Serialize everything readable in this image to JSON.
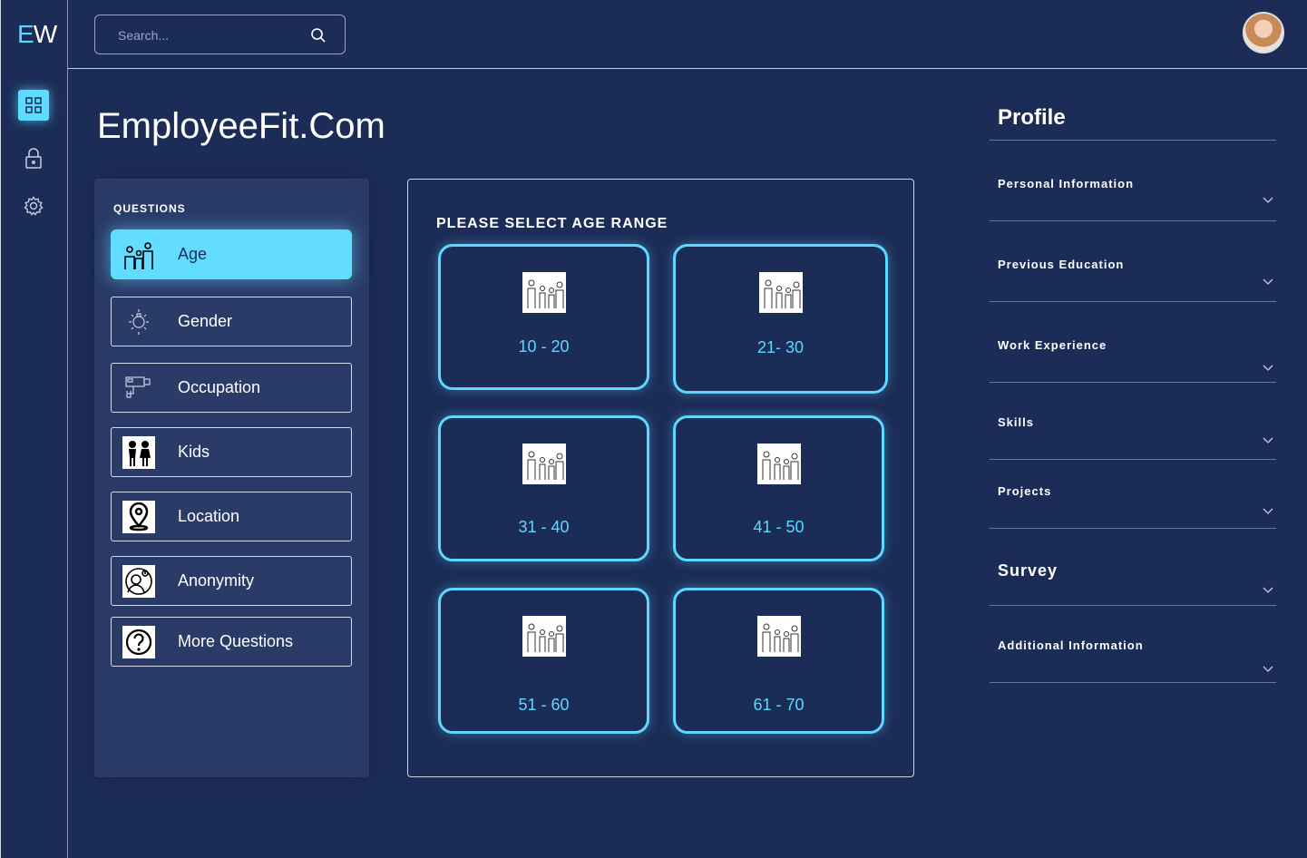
{
  "app": {
    "logo_e": "E",
    "logo_w": "W"
  },
  "search": {
    "placeholder": "Search..."
  },
  "page": {
    "title": "EmployeeFit.Com"
  },
  "questions": {
    "heading": "QUESTIONS",
    "items": [
      {
        "label": "Age",
        "icon": "family-icon",
        "active": true
      },
      {
        "label": "Gender",
        "icon": "lightbulb-icon",
        "active": false
      },
      {
        "label": "Occupation",
        "icon": "security-camera-icon",
        "active": false
      },
      {
        "label": "Kids",
        "icon": "kids-icon",
        "active": false
      },
      {
        "label": "Location",
        "icon": "location-pin-icon",
        "active": false
      },
      {
        "label": "Anonymity",
        "icon": "anonymity-icon",
        "active": false
      },
      {
        "label": "More Questions",
        "icon": "question-icon",
        "active": false
      }
    ]
  },
  "age": {
    "heading": "PLEASE SELECT AGE RANGE",
    "ranges": [
      "10 - 20",
      "21- 30",
      "31 - 40",
      "41 - 50",
      "51 - 60",
      "61 - 70"
    ]
  },
  "profile": {
    "title": "Profile",
    "items": [
      "Personal Information",
      "Previous Education",
      "Work Experience",
      "Skills",
      "Projects",
      "Survey",
      "Additional Information"
    ]
  },
  "colors": {
    "accent": "#5ed8ff",
    "background": "#1b2c57",
    "panel": "#2a3b68"
  }
}
